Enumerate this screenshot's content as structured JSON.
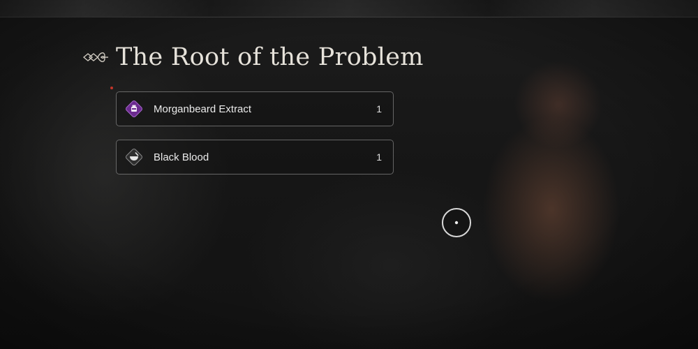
{
  "quest": {
    "title": "The Root of the Problem"
  },
  "requirements": [
    {
      "name": "Morganbeard Extract",
      "count": "1",
      "icon": "purple-potion-icon",
      "color": "#6b2a8f"
    },
    {
      "name": "Black Blood",
      "count": "1",
      "icon": "mortar-bowl-icon",
      "color": "#2e2e2e"
    }
  ],
  "colors": {
    "accent_purple": "#6b2a8f",
    "marker_red": "#c4352a",
    "text": "#e6e2da"
  }
}
